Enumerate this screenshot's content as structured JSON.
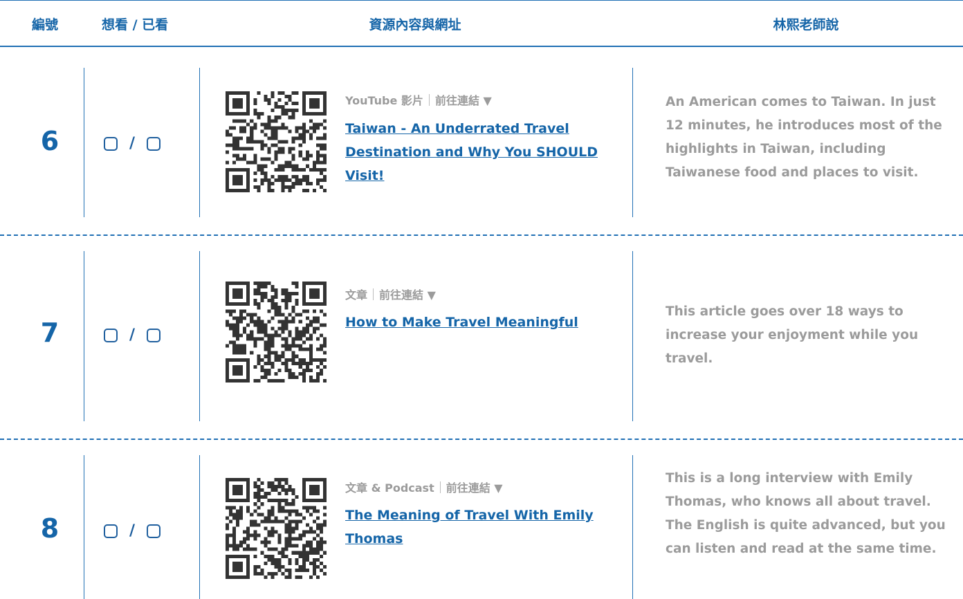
{
  "header": {
    "col_number": "編號",
    "col_watch": "想看 / 已看",
    "col_resource": "資源內容與網址",
    "col_teacher": "林熙老師說"
  },
  "check_separator": "/",
  "meta_separator": "｜",
  "colors": {
    "accent": "#1565a8",
    "muted": "#9b9b9b"
  },
  "rows": [
    {
      "number": "6",
      "type": "YouTube 影片",
      "action": "前往連結 ▼",
      "title": "Taiwan - An Underrated Travel Destination and Why You SHOULD Visit!",
      "description": "An American comes to Taiwan. In just 12 minutes, he introduces most of the highlights in Taiwan, including Taiwanese food and places to visit."
    },
    {
      "number": "7",
      "type": "文章",
      "action": "前往連結 ▼",
      "title": "How to Make Travel Meaningful",
      "description": "This article goes over 18 ways to increase your enjoyment while you travel."
    },
    {
      "number": "8",
      "type": "文章 & Podcast",
      "action": "前往連結 ▼",
      "title": "The Meaning of Travel With Emily Thomas",
      "description": "This is a long interview with Emily Thomas, who knows all about travel. The English is quite advanced, but you can listen and read at the same time."
    }
  ]
}
